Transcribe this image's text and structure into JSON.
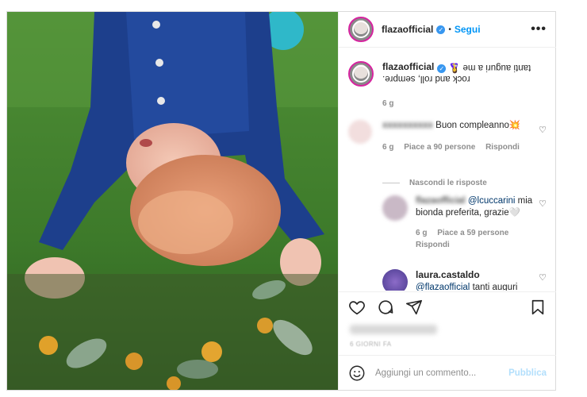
{
  "header": {
    "username": "flazaofficial",
    "verified_icon": "verified-badge-icon",
    "separator": "•",
    "follow_label": "Segui",
    "more_icon": "more-options-icon"
  },
  "caption": {
    "username": "flazaofficial",
    "text_line1": "tanti auguri a me 🤱",
    "text_line2": "rock and roll, sempre.",
    "age": "6 g"
  },
  "comments": [
    {
      "text": "Buon compleanno💥",
      "age": "6 g",
      "likes": "Piace a 90 persone",
      "reply_label": "Rispondi"
    }
  ],
  "hide_replies_label": "Nascondi le risposte",
  "replies": [
    {
      "username": "flazaofficial",
      "mention": "@lcuccarini",
      "text": "mia bionda preferita, grazie🤍",
      "age": "6 g",
      "likes": "Piace a 59 persone",
      "reply_label": "Rispondi"
    },
    {
      "username": "laura.castaldo",
      "mention": "@flazaofficial",
      "text": "tanti auguri"
    }
  ],
  "actions": {
    "like_icon": "heart-icon",
    "comment_icon": "comment-icon",
    "share_icon": "send-icon",
    "save_icon": "bookmark-icon"
  },
  "date": "6 GIORNI FA",
  "add_comment": {
    "placeholder": "Aggiungi un commento...",
    "publish_label": "Pubblica"
  },
  "colors": {
    "link_blue": "#0095f6",
    "publish_disabled": "#b2dffc",
    "verified": "#3897f0"
  }
}
